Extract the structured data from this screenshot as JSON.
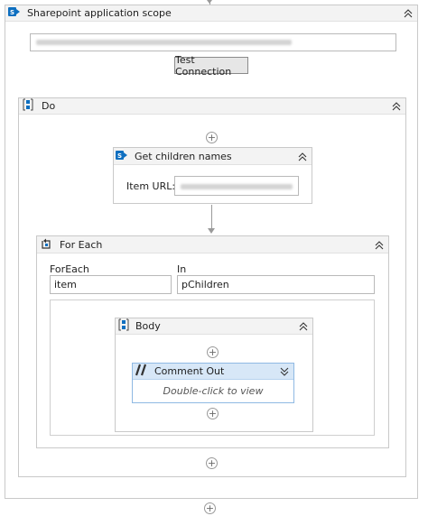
{
  "sharepoint_scope": {
    "title": "Sharepoint application scope",
    "url_value": "",
    "test_button_label": "Test Connection"
  },
  "do_sequence": {
    "title": "Do"
  },
  "get_children": {
    "title": "Get children names",
    "item_url_label": "Item URL:",
    "item_url_value": ""
  },
  "for_each": {
    "title": "For Each",
    "foreach_label": "ForEach",
    "foreach_value": "item",
    "in_label": "In",
    "in_value": "pChildren"
  },
  "body_sequence": {
    "title": "Body"
  },
  "comment_out": {
    "title": "Comment Out",
    "hint": "Double-click to view"
  },
  "colors": {
    "accent": "#0e6fc0",
    "selected_header": "#d7e7f7",
    "border": "#c9c9c9"
  },
  "icons": {
    "sharepoint": "sharepoint-icon",
    "sequence": "sequence-icon",
    "foreach": "foreach-icon",
    "comment": "comment-out-icon",
    "collapse": "collapse-chevron-icon",
    "expand": "expand-chevron-icon",
    "add": "add-activity-icon"
  }
}
